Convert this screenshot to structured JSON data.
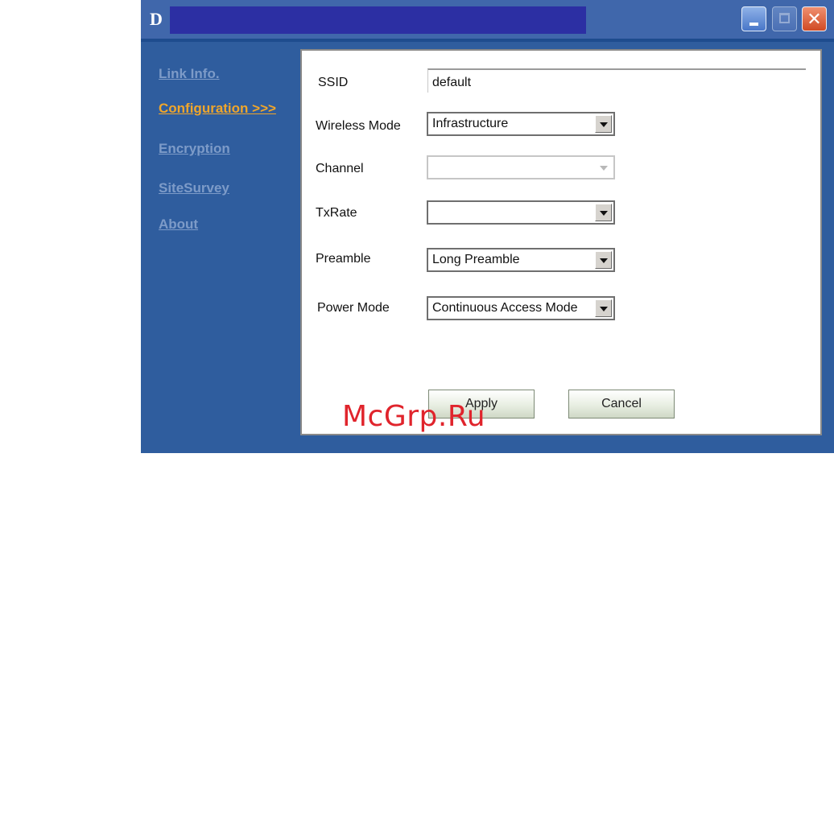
{
  "titlebar": {
    "logo": "D",
    "title": "",
    "minimize_icon": "minimize-icon",
    "maximize_icon": "maximize-icon",
    "close_icon": "close-icon",
    "close_glyph": "✕"
  },
  "nav": {
    "items": [
      {
        "label": "Link Info.",
        "active": false
      },
      {
        "label": "Configuration >>>",
        "active": true
      },
      {
        "label": "Encryption",
        "active": false
      },
      {
        "label": "SiteSurvey",
        "active": false
      },
      {
        "label": "About",
        "active": false
      }
    ]
  },
  "config": {
    "ssid": {
      "label": "SSID",
      "value": "default"
    },
    "wireless_mode": {
      "label": "Wireless Mode",
      "value": "Infrastructure"
    },
    "channel": {
      "label": "Channel",
      "value": "",
      "disabled": true
    },
    "txrate": {
      "label": "TxRate",
      "value": ""
    },
    "preamble": {
      "label": "Preamble",
      "value": "Long Preamble"
    },
    "power_mode": {
      "label": "Power Mode",
      "value": "Continuous Access Mode"
    }
  },
  "buttons": {
    "apply": "Apply",
    "cancel": "Cancel"
  },
  "watermark": "McGrp.Ru",
  "colors": {
    "window_blue": "#2f5d9e",
    "title_bar": "#2c2fa3",
    "nav_link": "#7d9bc8",
    "nav_active": "#f0a62b",
    "watermark": "#e0242c"
  }
}
